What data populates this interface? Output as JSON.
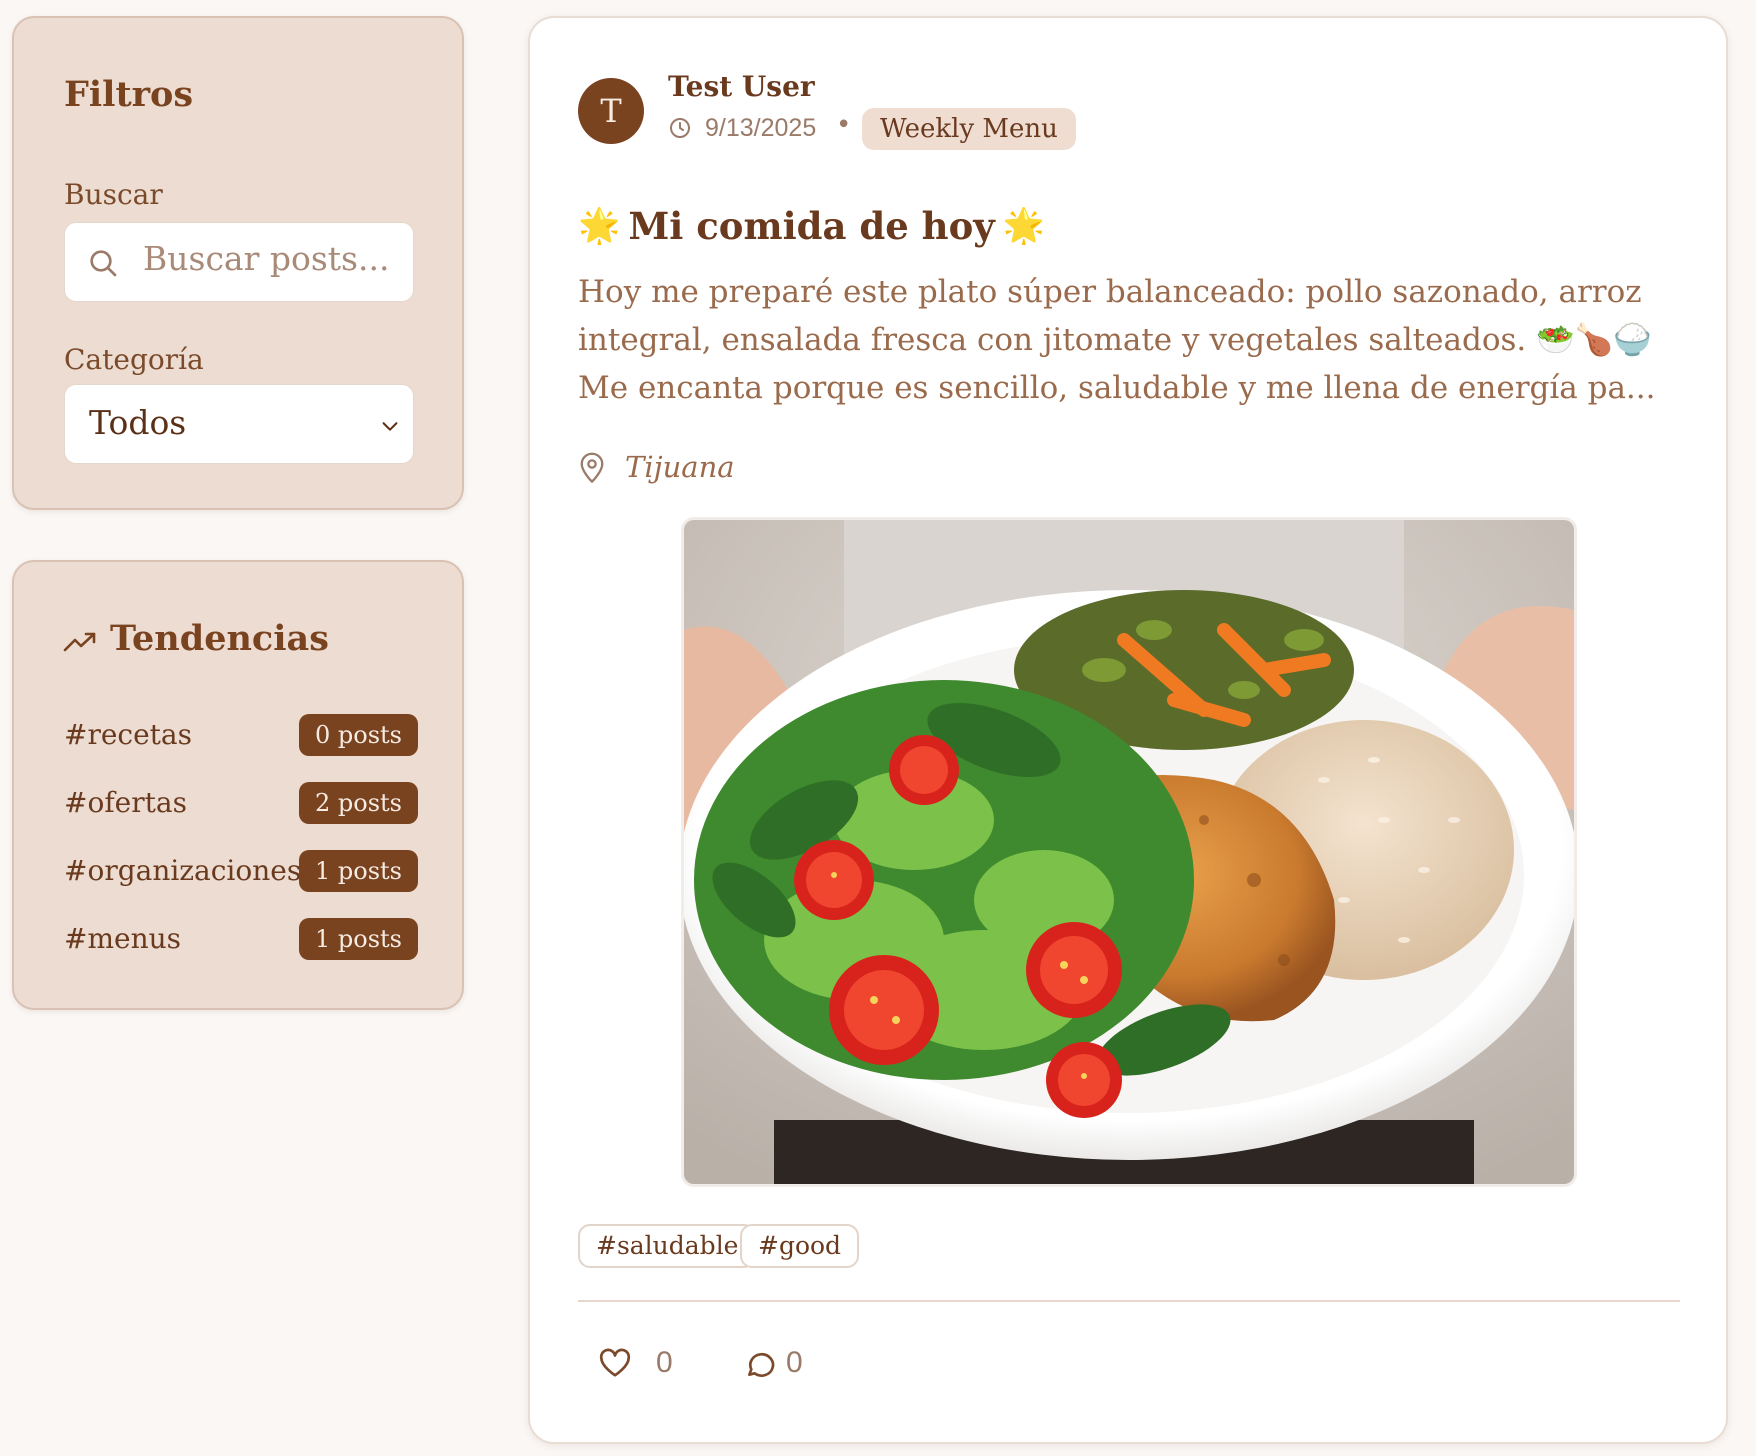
{
  "filters": {
    "title": "Filtros",
    "search_label": "Buscar",
    "search_placeholder": "Buscar posts...",
    "category_label": "Categoría",
    "category_value": "Todos"
  },
  "trends": {
    "title": "Tendencias",
    "items": [
      {
        "tag": "#recetas",
        "count": "0 posts"
      },
      {
        "tag": "#ofertas",
        "count": "2 posts"
      },
      {
        "tag": "#organizaciones",
        "count": "1 posts"
      },
      {
        "tag": "#menus",
        "count": "1 posts"
      }
    ]
  },
  "post": {
    "avatar_initial": "T",
    "author": "Test User",
    "date": "9/13/2025",
    "separator": "•",
    "category": "Weekly Menu",
    "title": "Mi comida de hoy",
    "body": "Hoy me preparé este plato súper balanceado: pollo sazonado, arroz integral, ensalada fresca con jitomate y vegetales salteados. 🥗🍗🍚 Me encanta porque es sencillo, saludable y me llena de energía pa...",
    "location": "Tijuana",
    "tags": [
      "#saludable",
      "#good"
    ],
    "likes": "0",
    "comments": "0"
  },
  "colors": {
    "brand": "#7a4320",
    "sidebar_bg": "#ecdcd1",
    "page_bg": "#faf7f5"
  }
}
